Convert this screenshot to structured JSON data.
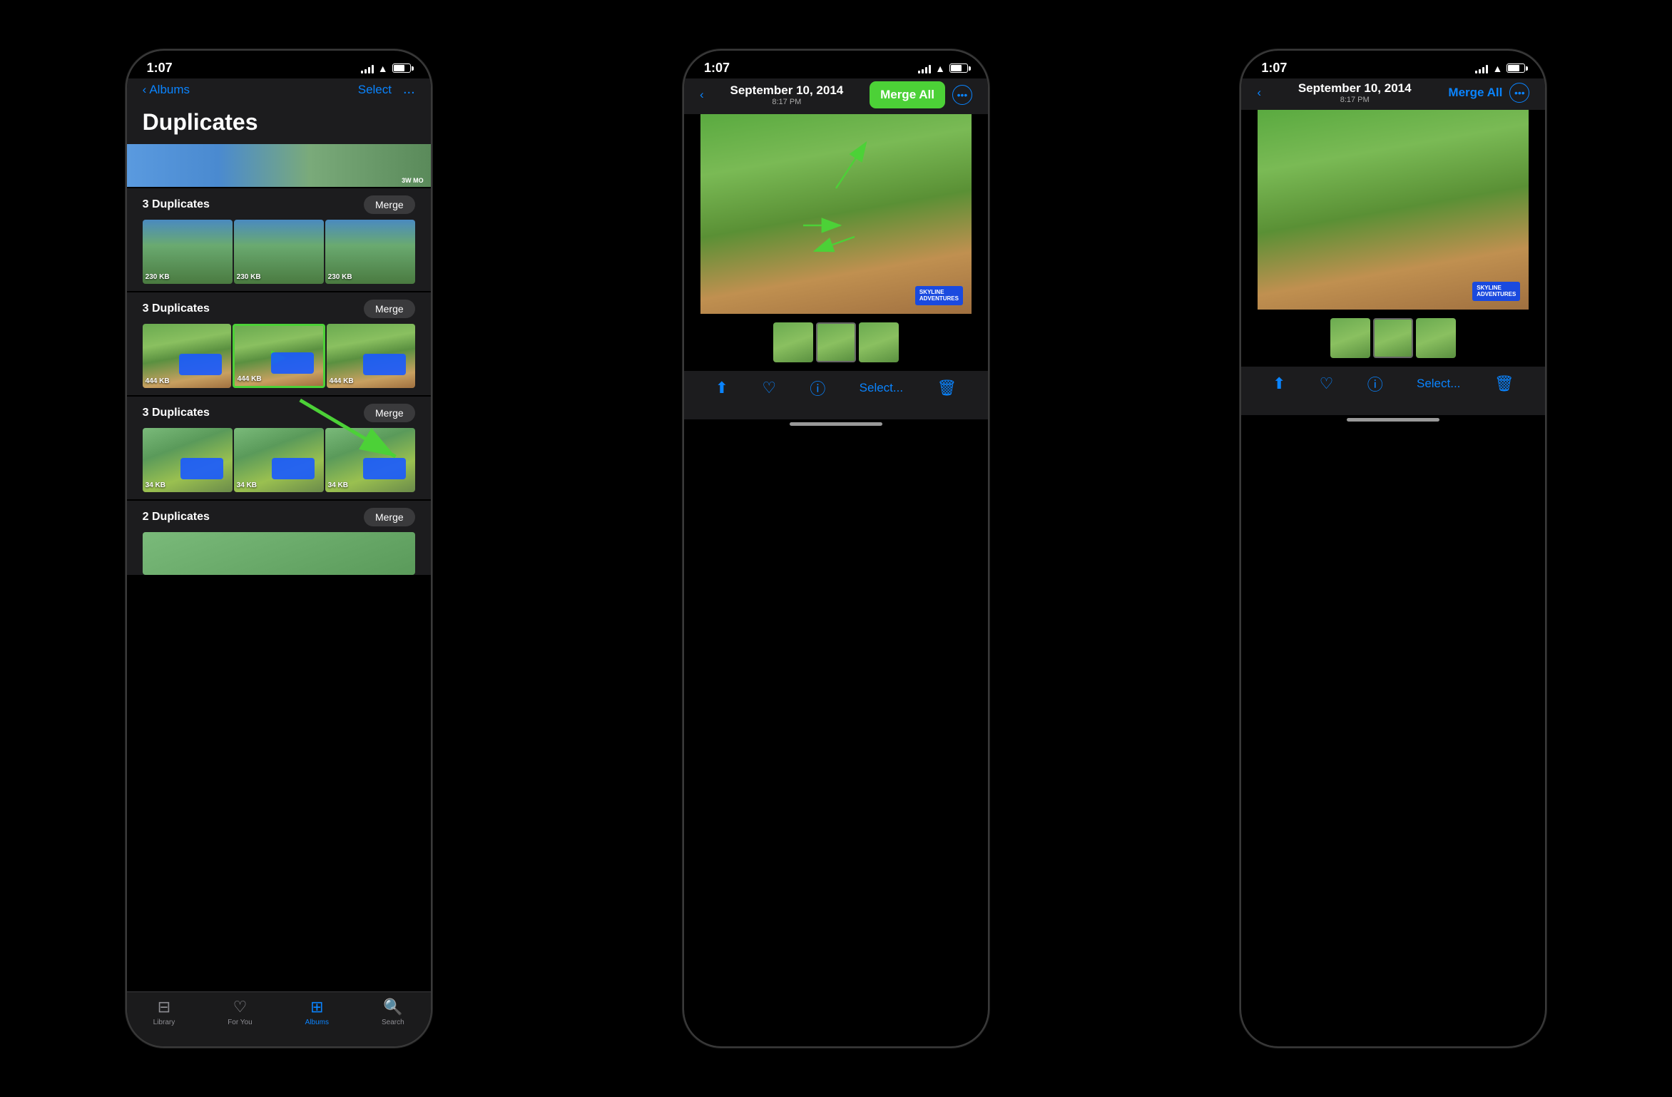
{
  "page": {
    "background": "#000000"
  },
  "phones": [
    {
      "id": "phone1",
      "status_time": "1:07",
      "nav": {
        "back_label": "Albums",
        "select_label": "Select",
        "more_label": "..."
      },
      "page_title": "Duplicates",
      "groups": [
        {
          "label": "3 Duplicates",
          "merge_label": "Merge",
          "thumbnails": [
            "230 KB",
            "230 KB",
            "230 KB"
          ],
          "type": "group_people"
        },
        {
          "label": "3 Duplicates",
          "merge_label": "Merge",
          "thumbnails": [
            "444 KB",
            "444 KB",
            "444 KB"
          ],
          "type": "zipline",
          "highlighted": 1
        },
        {
          "label": "3 Duplicates",
          "merge_label": "Merge",
          "thumbnails": [
            "34 KB",
            "34 KB",
            "34 KB"
          ],
          "type": "zipline_small"
        },
        {
          "label": "2 Duplicates",
          "merge_label": "Merge",
          "thumbnails": [],
          "type": "partial"
        }
      ],
      "tabs": [
        {
          "label": "Library",
          "icon": "📷",
          "active": false
        },
        {
          "label": "For You",
          "icon": "❤️",
          "active": false
        },
        {
          "label": "Albums",
          "icon": "🗂️",
          "active": true
        },
        {
          "label": "Search",
          "icon": "🔍",
          "active": false
        }
      ]
    },
    {
      "id": "phone2",
      "status_time": "1:07",
      "nav": {
        "date": "September 10, 2014",
        "time": "8:17 PM",
        "merge_all_label": "Merge All",
        "more_label": "..."
      },
      "filmstrip": [
        "thumb1",
        "thumb2",
        "thumb3"
      ],
      "toolbar_items": [
        "share",
        "heart",
        "info",
        "select",
        "trash"
      ]
    },
    {
      "id": "phone3",
      "status_time": "1:07",
      "nav": {
        "date": "September 10, 2014",
        "time": "8:17 PM",
        "merge_all_label": "Merge All",
        "more_label": "..."
      },
      "filmstrip": [
        "thumb1",
        "thumb2",
        "thumb3"
      ],
      "toolbar_items": [
        "share",
        "heart",
        "info",
        "select",
        "trash"
      ]
    }
  ],
  "annotations": {
    "green_arrow_up": "↑",
    "green_arrow_right": "→",
    "green_arrow_left_down": "↙",
    "highlight_color": "#4cd137"
  }
}
